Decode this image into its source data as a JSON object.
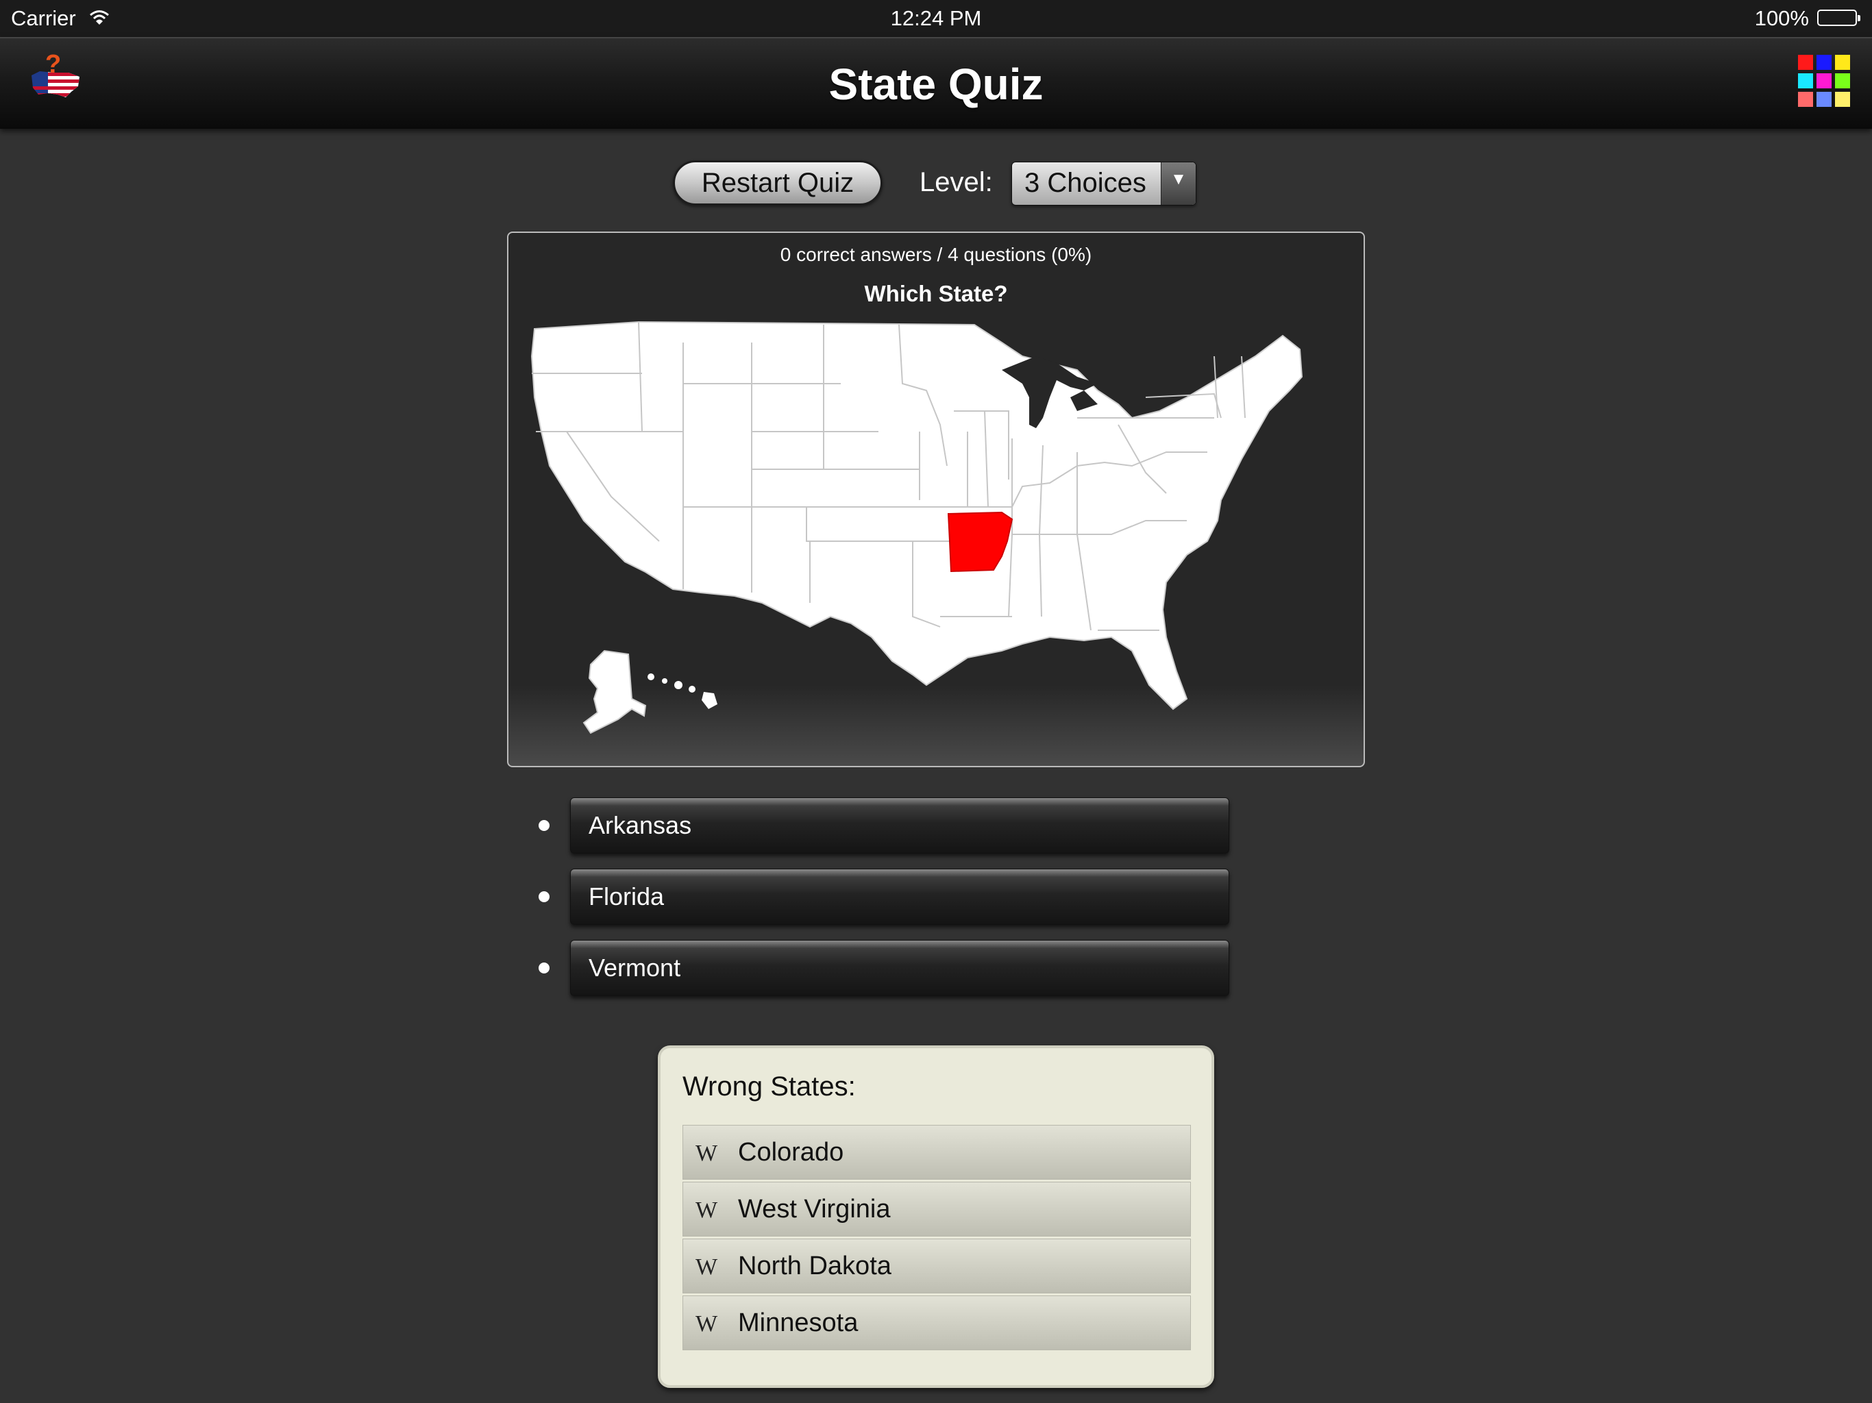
{
  "status_bar": {
    "carrier": "Carrier",
    "time": "12:24 PM",
    "battery": "100%"
  },
  "nav": {
    "title": "State Quiz",
    "app_icon": "us-flag-question-icon",
    "menu_icon": "color-grid-icon",
    "grid_colors": [
      "#ff1a1a",
      "#1a1aff",
      "#ffe81a",
      "#1ae8ff",
      "#ff1ad2",
      "#7aff1a",
      "#ff6a6a",
      "#6a8aff",
      "#fff06a"
    ]
  },
  "controls": {
    "restart_label": "Restart Quiz",
    "level_label": "Level:",
    "level_value": "3 Choices"
  },
  "quiz": {
    "score": "0 correct answers / 4 questions (0%)",
    "question": "Which State?",
    "highlight_color": "#ff0000",
    "highlighted_state": "Arkansas"
  },
  "answers": [
    {
      "label": "Arkansas"
    },
    {
      "label": "Florida"
    },
    {
      "label": "Vermont"
    }
  ],
  "wrong_states": {
    "title": "Wrong States:",
    "items": [
      {
        "icon": "wikipedia-icon",
        "glyph": "W",
        "name": "Colorado"
      },
      {
        "icon": "wikipedia-icon",
        "glyph": "W",
        "name": "West Virginia"
      },
      {
        "icon": "wikipedia-icon",
        "glyph": "W",
        "name": "North Dakota"
      },
      {
        "icon": "wikipedia-icon",
        "glyph": "W",
        "name": "Minnesota"
      }
    ]
  }
}
